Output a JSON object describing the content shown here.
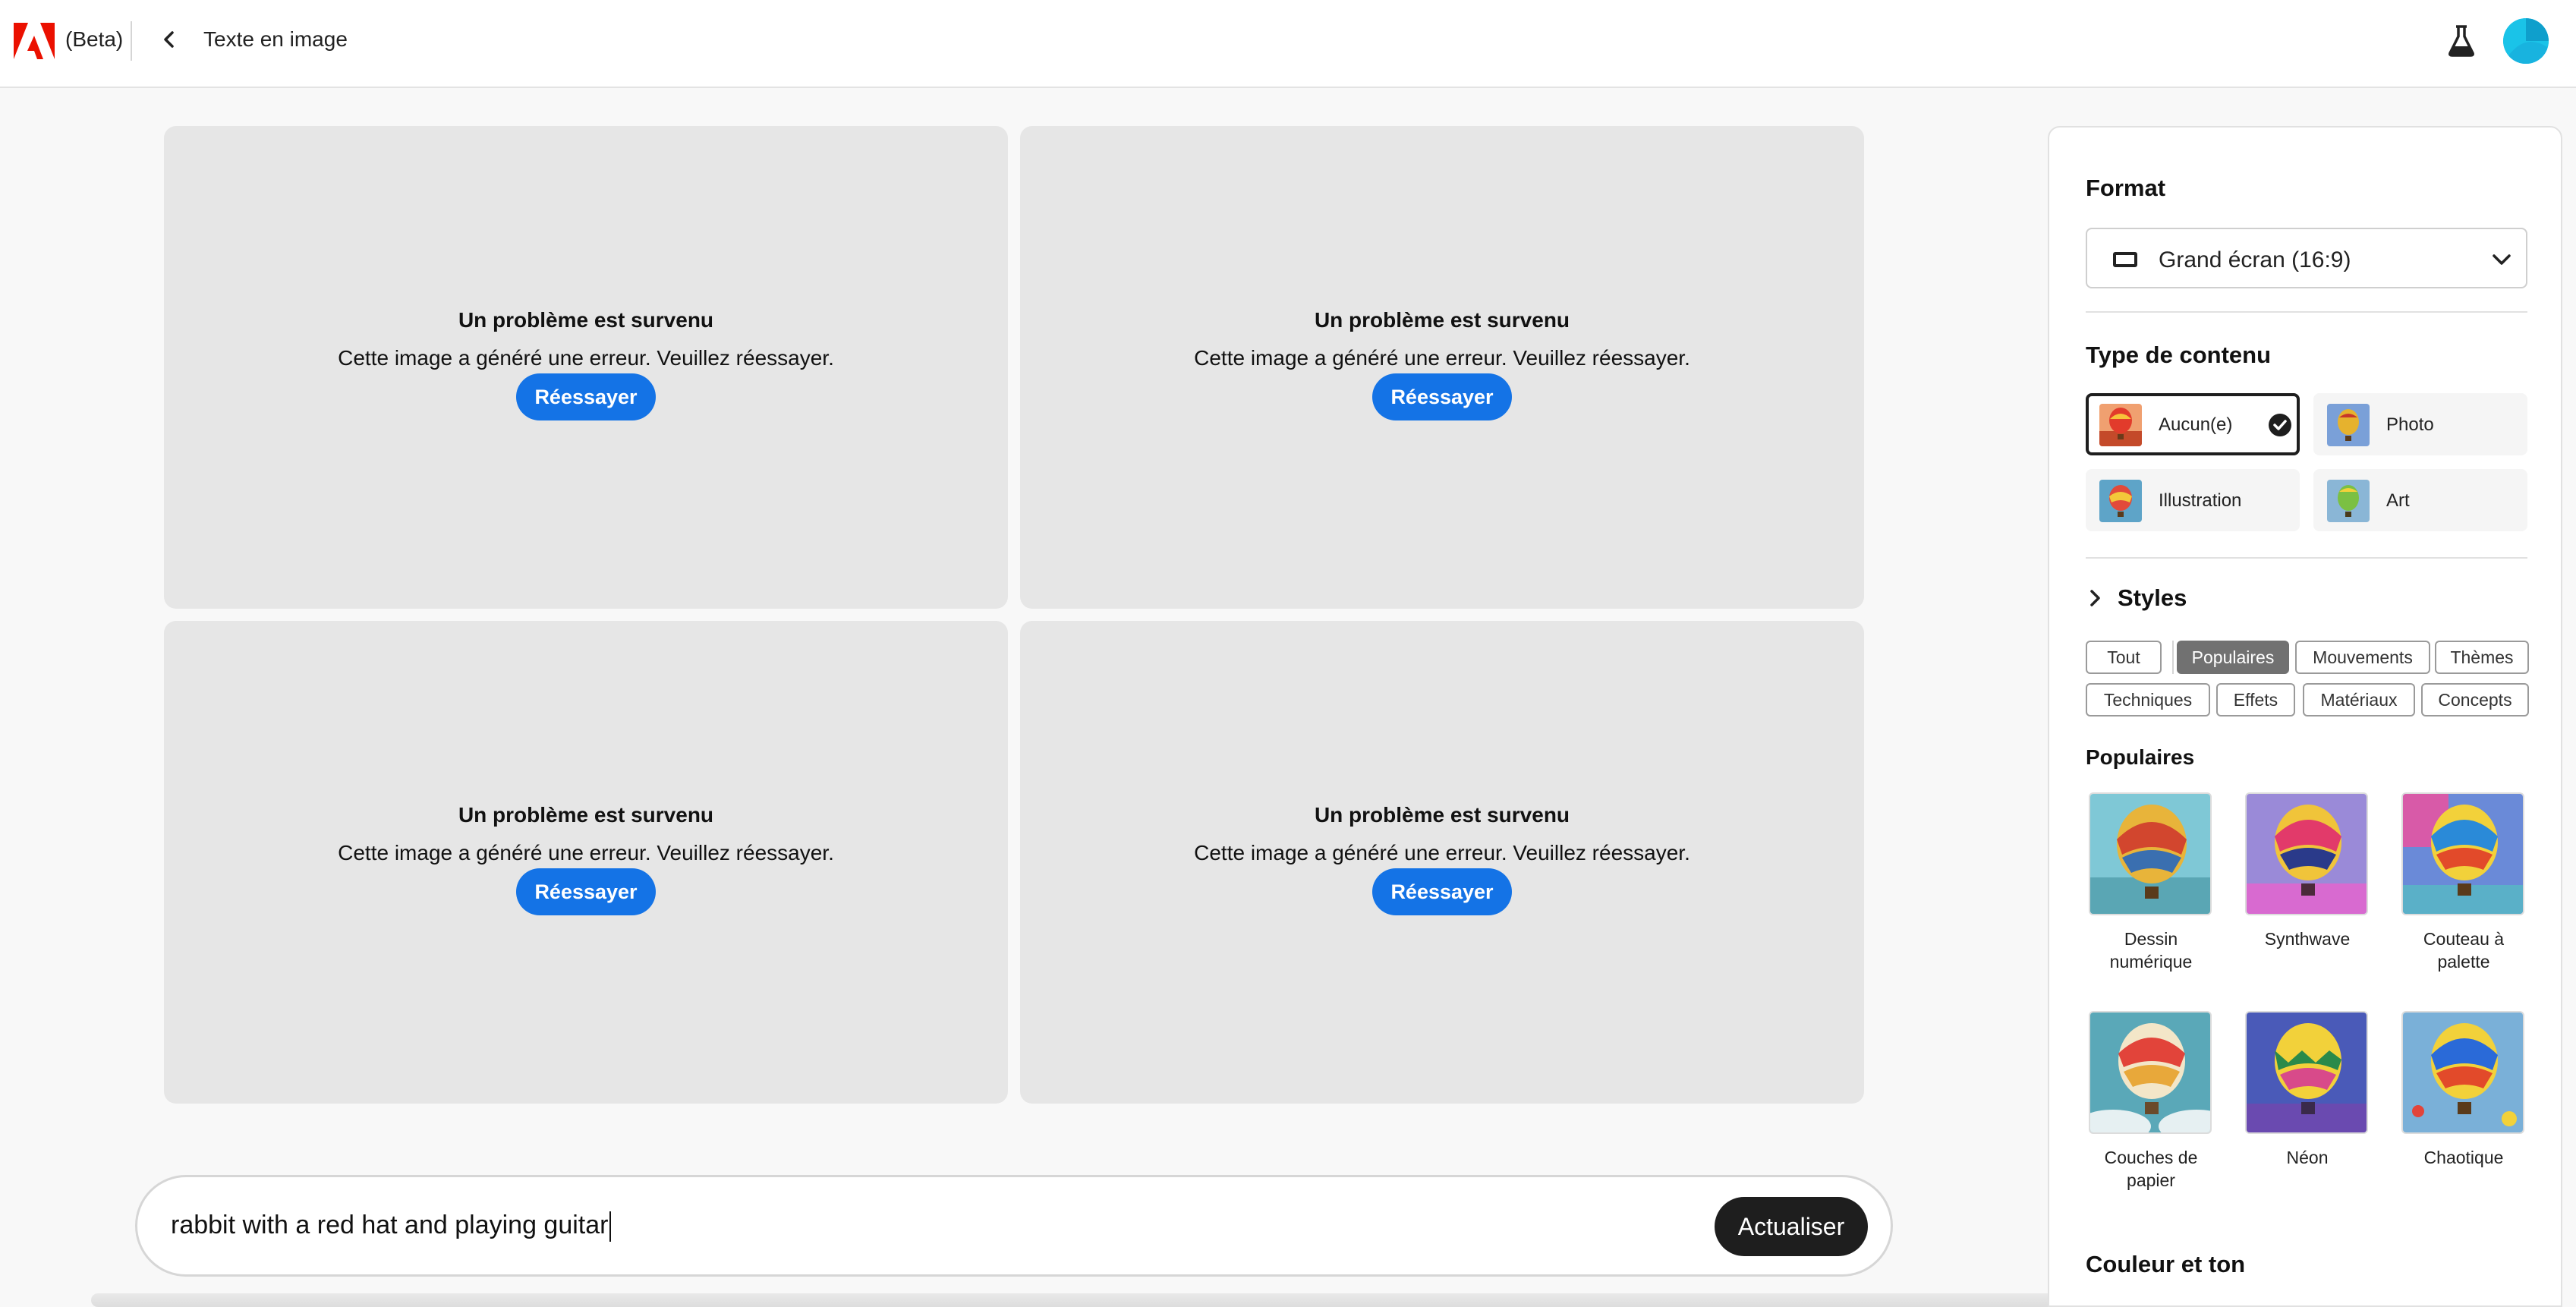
{
  "header": {
    "beta_label": "(Beta)",
    "page_title": "Texte en image",
    "brand_color": "#eb1000"
  },
  "results": [
    {
      "title": "Un problème est survenu",
      "message": "Cette image a généré une erreur. Veuillez réessayer.",
      "retry_label": "Réessayer"
    },
    {
      "title": "Un problème est survenu",
      "message": "Cette image a généré une erreur. Veuillez réessayer.",
      "retry_label": "Réessayer"
    },
    {
      "title": "Un problème est survenu",
      "message": "Cette image a généré une erreur. Veuillez réessayer.",
      "retry_label": "Réessayer"
    },
    {
      "title": "Un problème est survenu",
      "message": "Cette image a généré une erreur. Veuillez réessayer.",
      "retry_label": "Réessayer"
    }
  ],
  "prompt": {
    "value": "rabbit with a red hat and playing guitar",
    "update_label": "Actualiser"
  },
  "panel": {
    "format_title": "Format",
    "format_value": "Grand écran (16:9)",
    "content_type_title": "Type de contenu",
    "content_types": [
      {
        "label": "Aucun(e)",
        "selected": true,
        "icon": "balloon-thumbnail"
      },
      {
        "label": "Photo",
        "selected": false,
        "icon": "balloon-photo-thumbnail"
      },
      {
        "label": "Illustration",
        "selected": false,
        "icon": "balloon-illustration-thumbnail"
      },
      {
        "label": "Art",
        "selected": false,
        "icon": "balloon-art-thumbnail"
      }
    ],
    "styles_title": "Styles",
    "style_chips": [
      "Tout",
      "Populaires",
      "Mouvements",
      "Thèmes",
      "Techniques",
      "Effets",
      "Matériaux",
      "Concepts"
    ],
    "active_chip": "Populaires",
    "popular_title": "Populaires",
    "popular_styles": [
      {
        "line1": "Dessin",
        "line2": "numérique"
      },
      {
        "line1": "Synthwave",
        "line2": ""
      },
      {
        "line1": "Couteau à",
        "line2": "palette"
      },
      {
        "line1": "Couches de",
        "line2": "papier"
      },
      {
        "line1": "Néon",
        "line2": ""
      },
      {
        "line1": "Chaotique",
        "line2": ""
      }
    ],
    "color_title": "Couleur et ton"
  },
  "colors": {
    "accent": "#1473e6",
    "dark_button": "#1e1e1e",
    "avatar": "#1ac3e8"
  }
}
